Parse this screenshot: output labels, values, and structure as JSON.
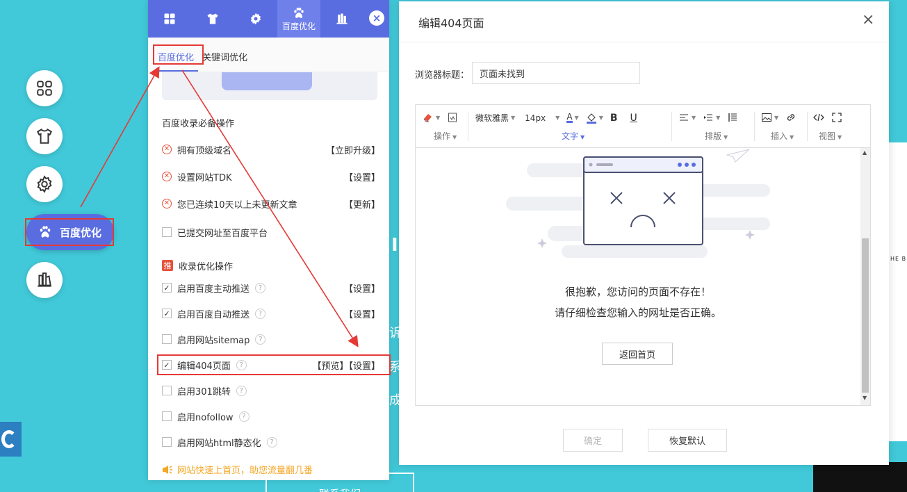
{
  "background": {
    "fragments": [
      "I.",
      "诉",
      "系",
      "成"
    ],
    "bottom_button": "联系我们",
    "right_text": "HE B"
  },
  "side_menu": {
    "items": [
      {
        "icon": "grid-icon"
      },
      {
        "icon": "shirt-icon"
      },
      {
        "icon": "gear-icon"
      },
      {
        "icon": "paw-icon",
        "label": "百度优化",
        "active": true
      },
      {
        "icon": "book-icon"
      }
    ]
  },
  "panel": {
    "tabs": [
      {
        "icon": "grid-icon",
        "label": ""
      },
      {
        "icon": "shirt-icon",
        "label": ""
      },
      {
        "icon": "gear-icon",
        "label": ""
      },
      {
        "icon": "paw-icon",
        "label": "百度优化"
      },
      {
        "icon": "book-icon",
        "label": ""
      }
    ],
    "close": "×",
    "subtabs": [
      "百度优化",
      "关键词优化"
    ],
    "section1": "百度收录必备操作",
    "required": [
      {
        "label": "拥有顶级域名",
        "action": "【立即升级】"
      },
      {
        "label": "设置网站TDK",
        "action": "【设置】"
      },
      {
        "label": "您已连续10天以上未更新文章",
        "action": "【更新】"
      }
    ],
    "submitted": "已提交网址至百度平台",
    "section2_badge": "推",
    "section2": "收录优化操作",
    "options": [
      {
        "label": "启用百度主动推送",
        "checked": true,
        "actions": "【设置】"
      },
      {
        "label": "启用百度自动推送",
        "checked": true,
        "actions": "【设置】"
      },
      {
        "label": "启用网站sitemap",
        "checked": false,
        "actions": ""
      },
      {
        "label": "编辑404页面",
        "checked": true,
        "actions": "【预览】【设置】"
      },
      {
        "label": "启用301跳转",
        "checked": false,
        "actions": ""
      },
      {
        "label": "启用nofollow",
        "checked": false,
        "actions": ""
      },
      {
        "label": "启用网站html静态化",
        "checked": false,
        "actions": ""
      }
    ],
    "help_mark": "?",
    "check_mark": "✓",
    "tip": "网站快速上首页，助您流量翻几番"
  },
  "modal": {
    "title": "编辑404页面",
    "close": "×",
    "browser_title_label": "浏览器标题：",
    "browser_title_value": "页面未找到",
    "toolbar": {
      "groups": [
        "操作",
        "文字",
        "排版",
        "插入",
        "视图"
      ],
      "font_family": "微软雅黑",
      "font_size": "14px",
      "bold": "B",
      "underline": "U",
      "font_color_glyph": "A"
    },
    "content": {
      "line1": "很抱歉，您访问的页面不存在！",
      "line2": "请仔细检查您输入的网址是否正确。",
      "home_button": "返回首页"
    },
    "ok_button": "确定",
    "reset_button": "恢复默认"
  },
  "colors": {
    "background": "#41c9d9",
    "accent": "#5a6de0",
    "highlight": "#e53935",
    "tip": "#f5a623"
  }
}
